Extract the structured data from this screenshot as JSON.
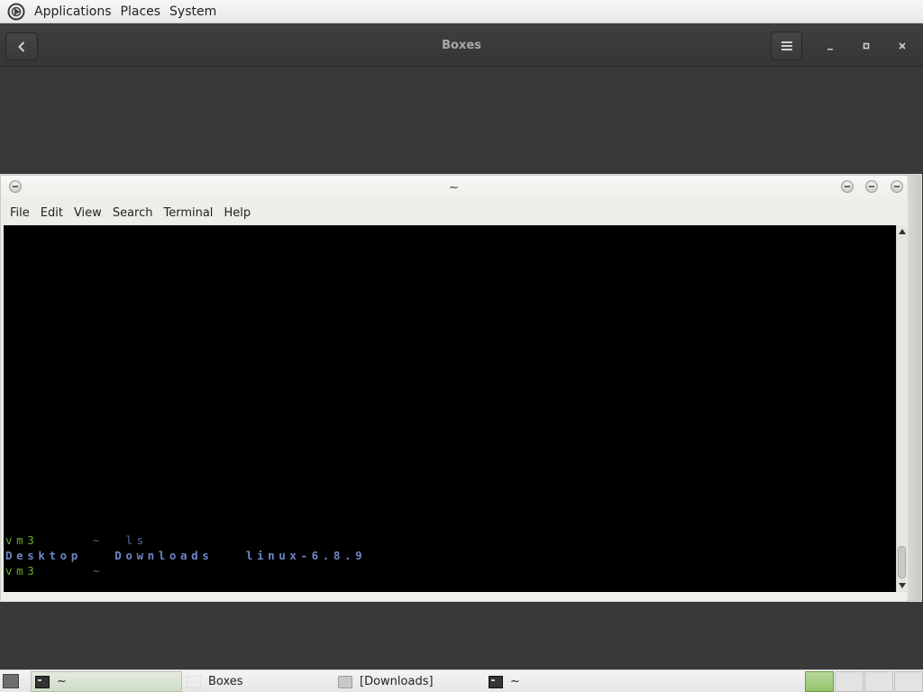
{
  "top_panel": {
    "menus": [
      "Applications",
      "Places",
      "System"
    ]
  },
  "boxes": {
    "title": "Boxes",
    "back_glyph": "‹",
    "menu_glyph": "≡",
    "min_glyph": "_",
    "max_glyph": "▪",
    "close_glyph": "✕"
  },
  "terminal": {
    "title": "~",
    "menu": [
      "File",
      "Edit",
      "View",
      "Search",
      "Terminal",
      "Help"
    ],
    "lines": {
      "l1_host": "vm3",
      "l1_path": "~",
      "l1_cmd": "ls",
      "l2_items": [
        "Desktop",
        "Downloads",
        "linux-6.8.9"
      ],
      "l3_host": "vm3",
      "l3_path": "~"
    }
  },
  "taskbar": {
    "tasks": [
      {
        "label": "~",
        "icon": "terminal-icon",
        "active": true
      },
      {
        "label": "Boxes",
        "icon": "boxes-icon",
        "active": false
      },
      {
        "label": "[Downloads]",
        "icon": "folder-icon",
        "active": false
      },
      {
        "label": "~",
        "icon": "terminal-icon",
        "active": false
      }
    ],
    "workspaces": 4,
    "active_workspace": 1
  },
  "colors": {
    "prompt_green": "#6fae2c",
    "dir_blue": "#6f86c9",
    "header_dark": "#3a3a3a"
  }
}
